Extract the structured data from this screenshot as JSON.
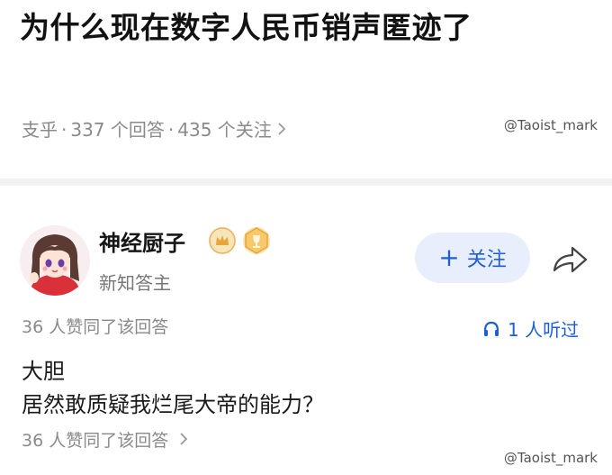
{
  "question": {
    "title": "为什么现在数字人民币销声匿迹了",
    "source": "支乎",
    "answers": "337 个回答",
    "followers": "435 个关注",
    "sep": "·"
  },
  "watermark": "@Taoist_mark",
  "answer": {
    "author": "神经厨子",
    "bio": "新知答主",
    "follow_label": "关注",
    "follow_plus": "+",
    "likes_text": "36 人赞同了该回答",
    "listen_text": "1 人听过",
    "body_lines": [
      "大胆",
      "居然敢质疑我烂尾大帝的能力？"
    ],
    "likes_footer": "36 人赞同了该回答"
  },
  "colors": {
    "accent": "#1f5fd6",
    "follow_bg": "#e8eefb",
    "badge": "#e8a63a"
  },
  "icons": [
    "chevron-right-icon",
    "crown-badge-icon",
    "trophy-badge-icon",
    "share-icon",
    "headphones-icon"
  ]
}
